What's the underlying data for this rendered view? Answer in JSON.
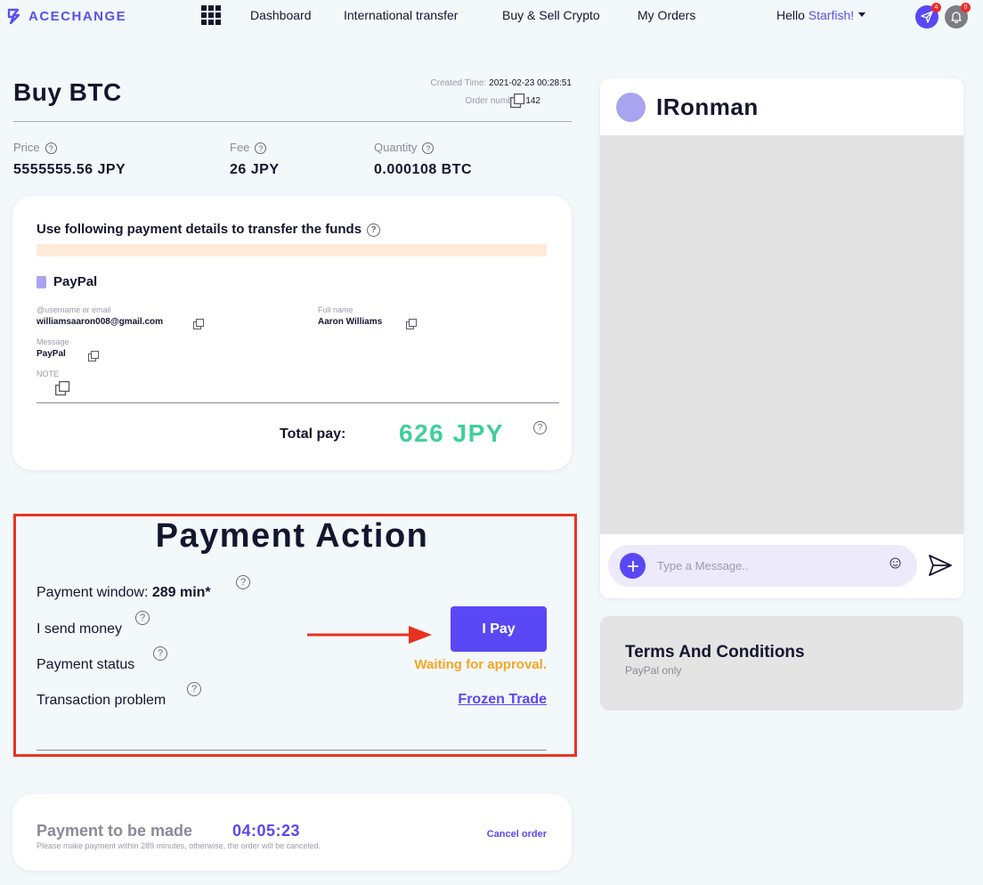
{
  "brand": {
    "name": "ACECHANGE",
    "accent": "#5a47f6"
  },
  "nav": {
    "links": [
      "Dashboard",
      "International transfer",
      "Buy & Sell Crypto",
      "My Orders"
    ],
    "greeting": "Hello ",
    "username": "Starfish!",
    "send_badge": "4",
    "bell_badge": "0"
  },
  "order": {
    "title": "Buy BTC",
    "created_label": "Created Time:",
    "created_value": "2021-02-23 00:28:51",
    "number_label": "Order number:",
    "number_value": "142",
    "price_label": "Price",
    "price_value": "5555555.56 JPY",
    "fee_label": "Fee",
    "fee_value": "26 JPY",
    "quantity_label": "Quantity",
    "quantity_value": "0.000108 BTC"
  },
  "payment_details": {
    "heading": "Use following payment details to transfer the funds",
    "method": "PayPal",
    "fields": {
      "username_label": "@username or email",
      "username_value": "williamsaaron008@gmail.com",
      "fullname_label": "Full name",
      "fullname_value": "Aaron Williams",
      "message_label": "Message",
      "message_value": "PayPal",
      "note_label": "NOTE"
    },
    "total_label": "Total pay:",
    "total_value": "626 JPY"
  },
  "payment_action": {
    "title": "Payment Action",
    "window_label": "Payment window: ",
    "window_value": "289 min*",
    "send_label": "I send money",
    "status_label": "Payment status",
    "problem_label": "Transaction problem",
    "pay_button": "I Pay",
    "status_value": "Waiting for approval.",
    "problem_link": "Frozen Trade"
  },
  "countdown": {
    "label": "Payment to be made",
    "timer": "04:05:23",
    "note": "Please make payment within 289 minutes, otherwise, the order will be canceled.",
    "cancel": "Cancel order"
  },
  "chat": {
    "name": "IRonman",
    "placeholder": "Type a Message.."
  },
  "terms": {
    "title": "Terms And Conditions",
    "subtitle": "PayPal only"
  }
}
